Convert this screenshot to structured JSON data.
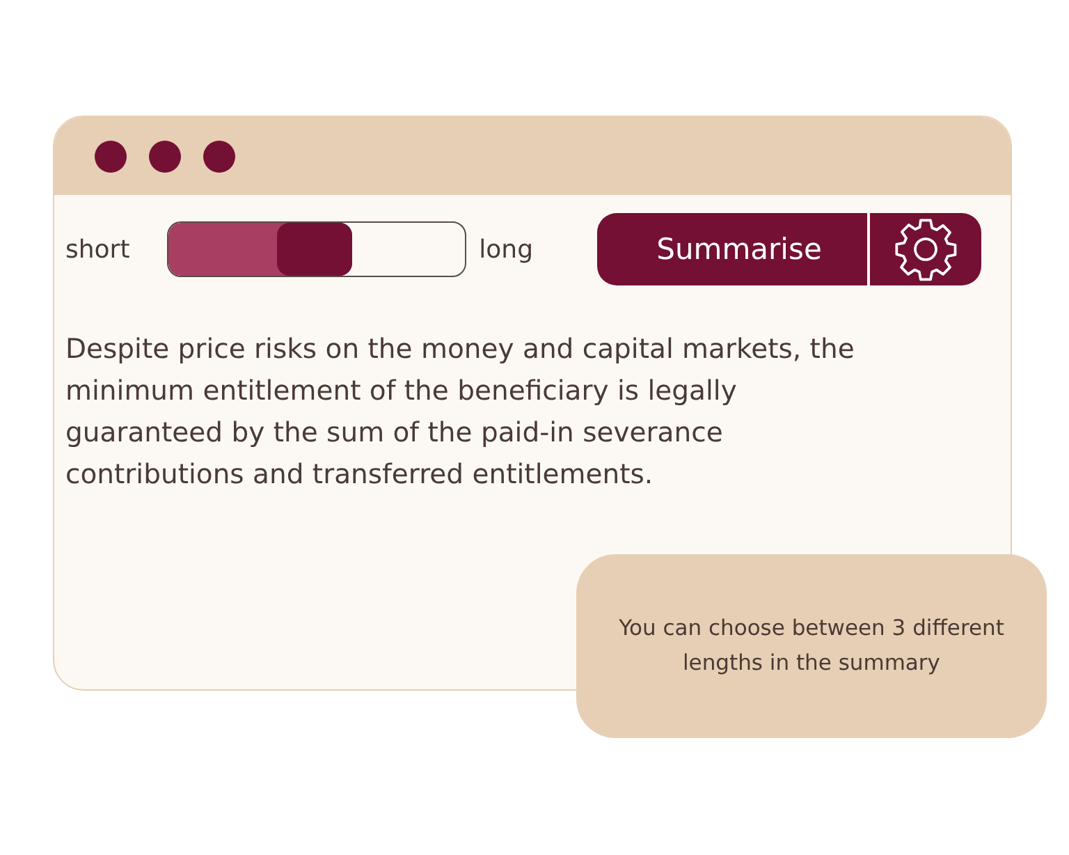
{
  "window": {
    "controls": [
      {
        "kind": "dot"
      },
      {
        "kind": "dot"
      },
      {
        "kind": "dot"
      }
    ]
  },
  "length_slider": {
    "min_label": "short",
    "max_label": "long",
    "level": 0.62
  },
  "summarise_button": {
    "label": "Summarise"
  },
  "summary_text": "Despite price risks on the money and capital markets, the minimum entitlement of the beneficiary is legally guaranteed by the sum of the paid-in severance contributions and transferred entitlements.",
  "tooltip": {
    "text": "You can choose between 3 different lengths in the summary"
  }
}
